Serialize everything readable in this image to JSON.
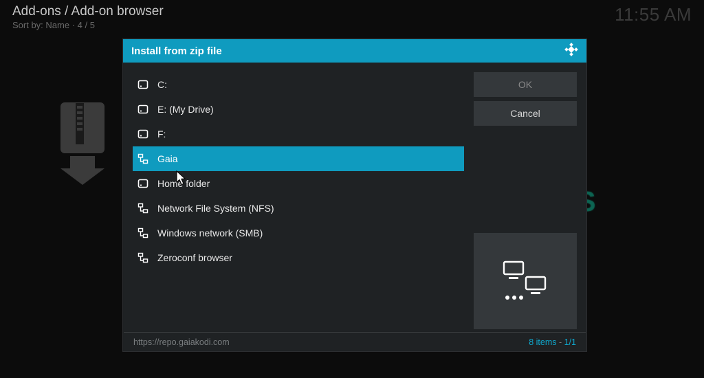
{
  "header": {
    "title": "Add-ons / Add-on browser",
    "sort_label": "Sort by: Name",
    "position": "4 / 5"
  },
  "clock": "11:55 AM",
  "watermark": "TECHFOLLOWS",
  "dialog": {
    "title": "Install from zip file",
    "ok": "OK",
    "cancel": "Cancel",
    "footer_path": "https://repo.gaiakodi.com",
    "item_count": "8 items",
    "page": "1/1",
    "items": [
      {
        "icon": "hdd",
        "label": "C:",
        "selected": false
      },
      {
        "icon": "hdd",
        "label": "E: (My Drive)",
        "selected": false
      },
      {
        "icon": "hdd",
        "label": "F:",
        "selected": false
      },
      {
        "icon": "network",
        "label": "Gaia",
        "selected": true
      },
      {
        "icon": "hdd",
        "label": "Home folder",
        "selected": false
      },
      {
        "icon": "network",
        "label": "Network File System (NFS)",
        "selected": false
      },
      {
        "icon": "network",
        "label": "Windows network (SMB)",
        "selected": false
      },
      {
        "icon": "network",
        "label": "Zeroconf browser",
        "selected": false
      }
    ]
  }
}
